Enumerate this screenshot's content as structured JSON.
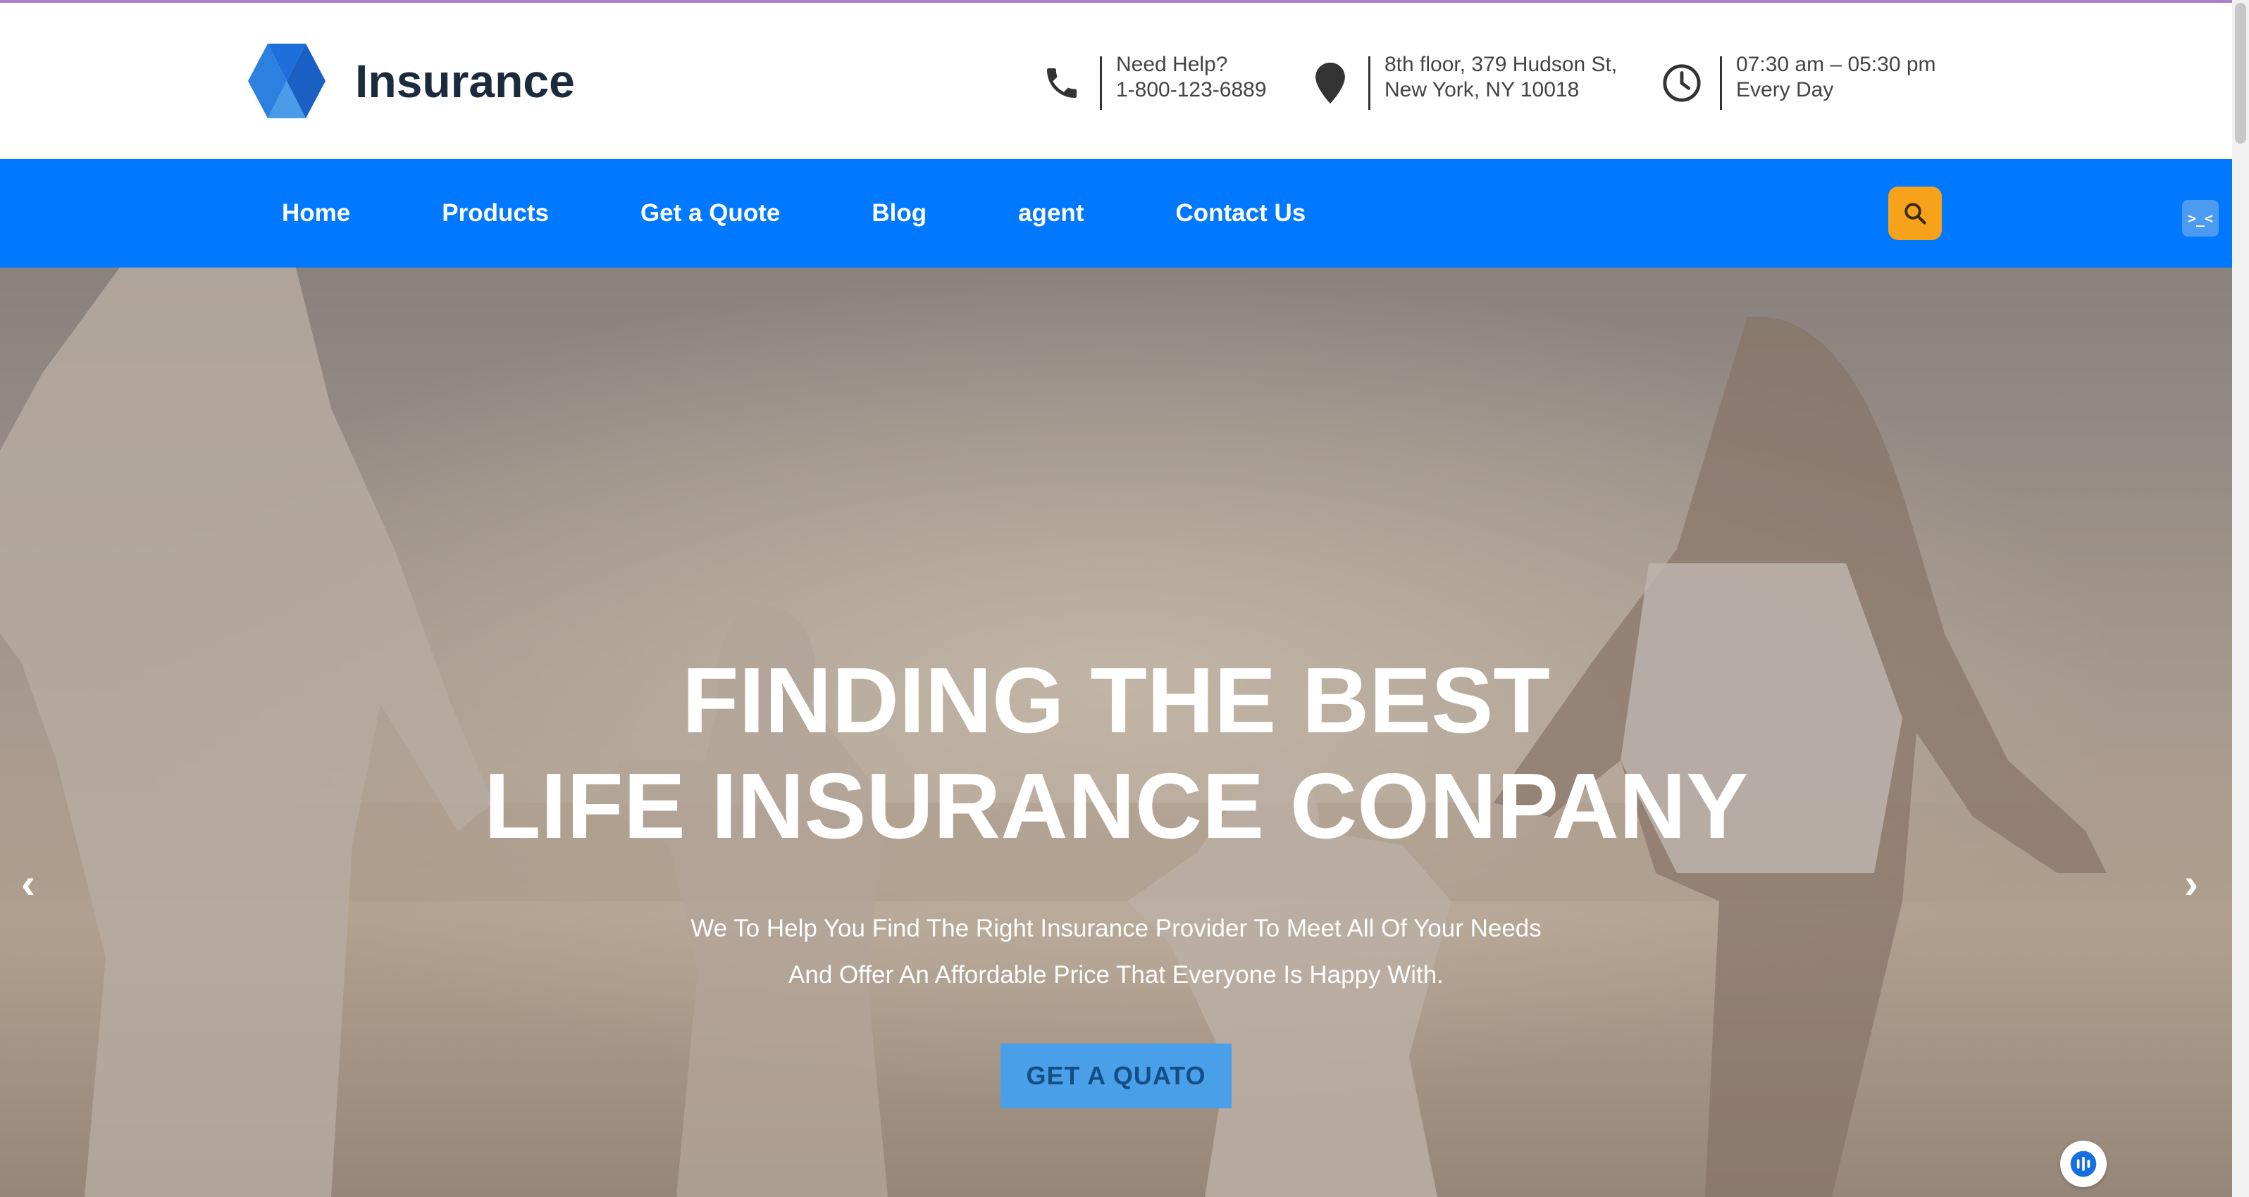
{
  "brand": {
    "name": "Insurance",
    "color": "#0078ff"
  },
  "header": {
    "help_label": "Need Help?",
    "phone": "1-800-123-6889",
    "address_line1": "8th floor, 379 Hudson St,",
    "address_line2": "New York, NY 10018",
    "hours_line1": "07:30 am – 05:30 pm",
    "hours_line2": "Every Day",
    "icons": [
      "phone-icon",
      "map-pin-icon",
      "clock-icon"
    ]
  },
  "nav": {
    "items": [
      {
        "label": "Home"
      },
      {
        "label": "Products"
      },
      {
        "label": "Get a Quote"
      },
      {
        "label": "Blog"
      },
      {
        "label": "agent"
      },
      {
        "label": "Contact Us"
      }
    ],
    "search_icon": "search-icon",
    "search_color": "#f7a21b",
    "extension_text": ">_<"
  },
  "hero": {
    "title_line1": "FINDING THE BEST",
    "title_line2": "LIFE INSURANCE CONPANY",
    "subtitle_line1": "We To Help You Find The Right Insurance Provider To Meet All Of Your Needs",
    "subtitle_line2": "And Offer An Affordable Price That Everyone Is Happy With.",
    "cta_label": "GET A QUATO",
    "prev_arrow": "‹",
    "next_arrow": "›"
  }
}
